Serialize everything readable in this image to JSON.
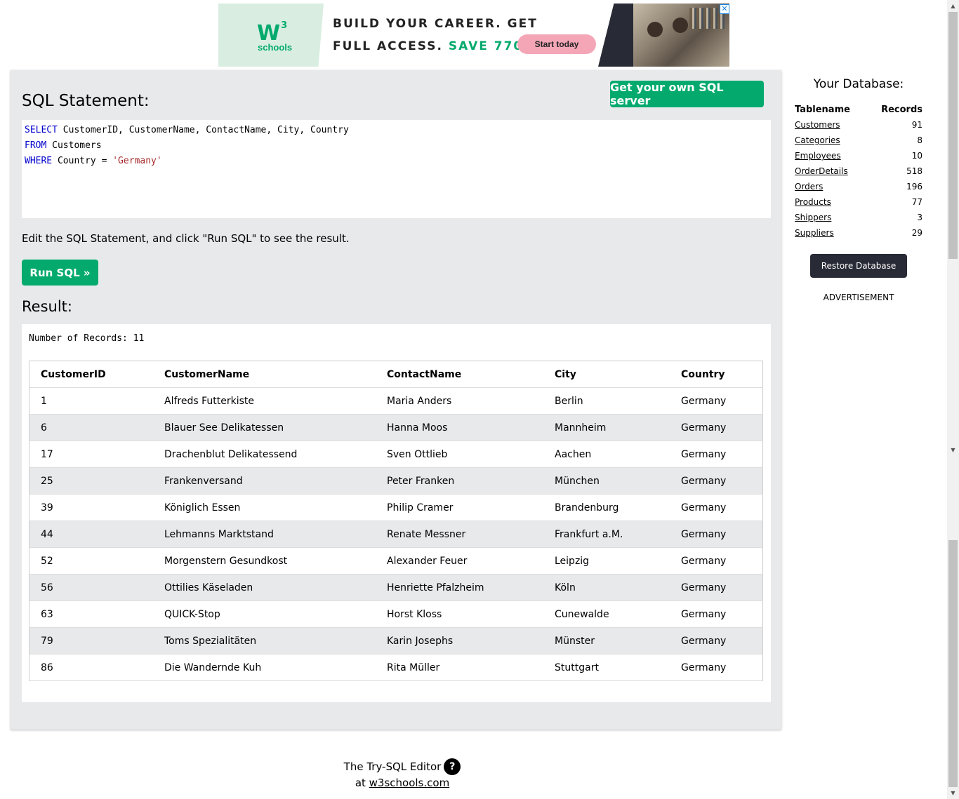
{
  "ad": {
    "logo_mark": "W",
    "logo_sup": "3",
    "logo_text": "schools",
    "headline_1": "BUILD YOUR CAREER. GET",
    "headline_2": "FULL ACCESS. ",
    "headline_highlight": "SAVE 770$",
    "cta": "Start today",
    "close_glyph": "✕"
  },
  "editor_panel": {
    "heading": "SQL Statement:",
    "own_server_button": "Get your own SQL server",
    "code": {
      "line1_kw": "SELECT",
      "line1_rest": " CustomerID, CustomerName, ContactName, City, Country",
      "line2_kw": "FROM",
      "line2_rest": " Customers",
      "line3_kw": "WHERE",
      "line3_rest": " Country = ",
      "line3_str": "'Germany'"
    },
    "hint": "Edit the SQL Statement, and click \"Run SQL\" to see the result.",
    "run_button": "Run SQL »"
  },
  "result": {
    "heading": "Result:",
    "count_text": "Number of Records: 11",
    "columns": [
      "CustomerID",
      "CustomerName",
      "ContactName",
      "City",
      "Country"
    ],
    "rows": [
      [
        "1",
        "Alfreds Futterkiste",
        "Maria Anders",
        "Berlin",
        "Germany"
      ],
      [
        "6",
        "Blauer See Delikatessen",
        "Hanna Moos",
        "Mannheim",
        "Germany"
      ],
      [
        "17",
        "Drachenblut Delikatessend",
        "Sven Ottlieb",
        "Aachen",
        "Germany"
      ],
      [
        "25",
        "Frankenversand",
        "Peter Franken",
        "München",
        "Germany"
      ],
      [
        "39",
        "Königlich Essen",
        "Philip Cramer",
        "Brandenburg",
        "Germany"
      ],
      [
        "44",
        "Lehmanns Marktstand",
        "Renate Messner",
        "Frankfurt a.M.",
        "Germany"
      ],
      [
        "52",
        "Morgenstern Gesundkost",
        "Alexander Feuer",
        "Leipzig",
        "Germany"
      ],
      [
        "56",
        "Ottilies Käseladen",
        "Henriette Pfalzheim",
        "Köln",
        "Germany"
      ],
      [
        "63",
        "QUICK-Stop",
        "Horst Kloss",
        "Cunewalde",
        "Germany"
      ],
      [
        "79",
        "Toms Spezialitäten",
        "Karin Josephs",
        "Münster",
        "Germany"
      ],
      [
        "86",
        "Die Wandernde Kuh",
        "Rita Müller",
        "Stuttgart",
        "Germany"
      ]
    ]
  },
  "sidebar": {
    "title": "Your Database:",
    "col_name": "Tablename",
    "col_records": "Records",
    "tables": [
      {
        "name": "Customers",
        "records": "91"
      },
      {
        "name": "Categories",
        "records": "8"
      },
      {
        "name": "Employees",
        "records": "10"
      },
      {
        "name": "OrderDetails",
        "records": "518"
      },
      {
        "name": "Orders",
        "records": "196"
      },
      {
        "name": "Products",
        "records": "77"
      },
      {
        "name": "Shippers",
        "records": "3"
      },
      {
        "name": "Suppliers",
        "records": "29"
      }
    ],
    "restore_button": "Restore Database",
    "ad_label": "ADVERTISEMENT"
  },
  "footer": {
    "line1": "The Try-SQL Editor",
    "help_glyph": "?",
    "at": "at ",
    "link": "w3schools.com"
  },
  "colors": {
    "accent_green": "#04aa6d",
    "dark_button": "#282a35",
    "panel_bg": "#e7e9eb"
  }
}
